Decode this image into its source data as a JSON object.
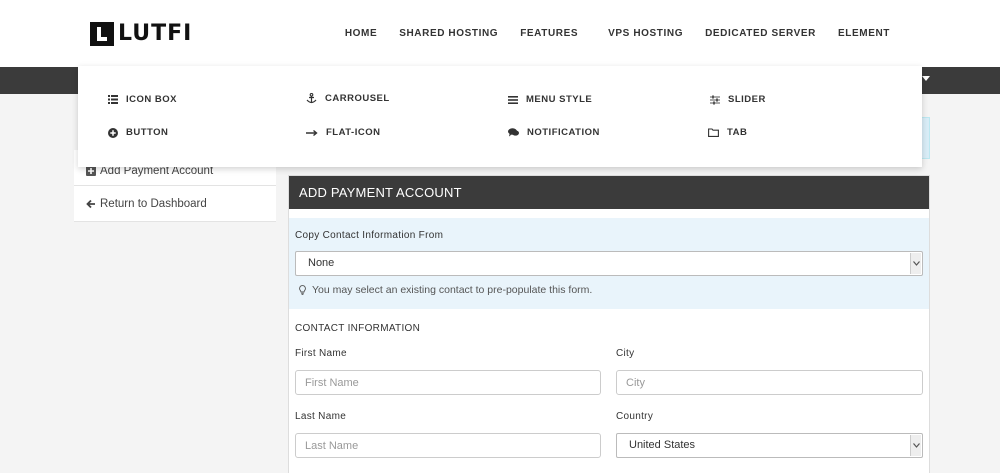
{
  "brand": {
    "logo_text": "LUTFI"
  },
  "nav": {
    "items": [
      "HOME",
      "SHARED HOSTING",
      "FEATURES",
      "VPS HOSTING",
      "DEDICATED SERVER",
      "ELEMENT"
    ]
  },
  "mega_menu": {
    "items": [
      {
        "label": "ICON BOX",
        "icon": "list-icon"
      },
      {
        "label": "CARROUSEL",
        "icon": "anchor-icon"
      },
      {
        "label": "MENU STYLE",
        "icon": "menu-icon"
      },
      {
        "label": "SLIDER",
        "icon": "sliders-icon"
      },
      {
        "label": "BUTTON",
        "icon": "plus-circle-icon"
      },
      {
        "label": "FLAT-ICON",
        "icon": "arrow-right-icon"
      },
      {
        "label": "NOTIFICATION",
        "icon": "comments-icon"
      },
      {
        "label": "TAB",
        "icon": "folder-icon"
      }
    ]
  },
  "sidebar": {
    "items": [
      {
        "label": "Add Payment Account",
        "icon": "plus-square-icon"
      },
      {
        "label": "Return to Dashboard",
        "icon": "arrow-left-icon"
      }
    ]
  },
  "panel": {
    "title": "ADD PAYMENT ACCOUNT",
    "copy_label": "Copy Contact Information From",
    "copy_value": "None",
    "help_text": "You may select an existing contact to pre-populate this form.",
    "section_title": "CONTACT INFORMATION",
    "fields": {
      "first_name": {
        "label": "First Name",
        "placeholder": "First Name"
      },
      "city": {
        "label": "City",
        "placeholder": "City"
      },
      "last_name": {
        "label": "Last Name",
        "placeholder": "Last Name"
      },
      "country": {
        "label": "Country",
        "value": "United States"
      }
    }
  },
  "colors": {
    "dark": "#3b3b3b",
    "info_bg": "#e9f4fb"
  }
}
